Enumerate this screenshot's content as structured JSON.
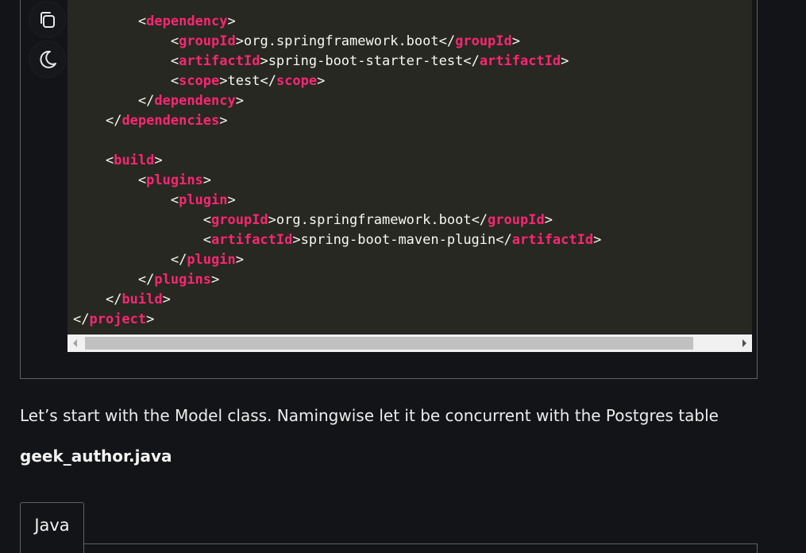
{
  "toolbar": {
    "copy_icon": "copy-icon",
    "theme_icon": "moon-icon"
  },
  "code": {
    "lines": [
      {
        "indent": "        ",
        "close": false,
        "tag": "dependency",
        "text": "",
        "end_tag": ""
      },
      {
        "indent": "            ",
        "close": false,
        "tag": "groupId",
        "text": "org.springframework.boot",
        "end_tag": "groupId"
      },
      {
        "indent": "            ",
        "close": false,
        "tag": "artifactId",
        "text": "spring-boot-starter-test",
        "end_tag": "artifactId"
      },
      {
        "indent": "            ",
        "close": false,
        "tag": "scope",
        "text": "test",
        "end_tag": "scope"
      },
      {
        "indent": "        ",
        "close": true,
        "tag": "dependency",
        "text": "",
        "end_tag": ""
      },
      {
        "indent": "    ",
        "close": true,
        "tag": "dependencies",
        "text": "",
        "end_tag": ""
      },
      {
        "indent": "",
        "close": false,
        "tag": "",
        "text": "",
        "end_tag": ""
      },
      {
        "indent": "    ",
        "close": false,
        "tag": "build",
        "text": "",
        "end_tag": ""
      },
      {
        "indent": "        ",
        "close": false,
        "tag": "plugins",
        "text": "",
        "end_tag": ""
      },
      {
        "indent": "            ",
        "close": false,
        "tag": "plugin",
        "text": "",
        "end_tag": ""
      },
      {
        "indent": "                ",
        "close": false,
        "tag": "groupId",
        "text": "org.springframework.boot",
        "end_tag": "groupId"
      },
      {
        "indent": "                ",
        "close": false,
        "tag": "artifactId",
        "text": "spring-boot-maven-plugin",
        "end_tag": "artifactId"
      },
      {
        "indent": "            ",
        "close": true,
        "tag": "plugin",
        "text": "",
        "end_tag": ""
      },
      {
        "indent": "        ",
        "close": true,
        "tag": "plugins",
        "text": "",
        "end_tag": ""
      },
      {
        "indent": "    ",
        "close": true,
        "tag": "build",
        "text": "",
        "end_tag": ""
      },
      {
        "indent": "",
        "close": true,
        "tag": "project",
        "text": "",
        "end_tag": ""
      }
    ]
  },
  "article": {
    "paragraph": "Let’s start with the Model class. Namingwise let it be concurrent with the Postgres table",
    "filename": "geek_author.java"
  },
  "tabs": [
    {
      "label": "Java",
      "active": true
    }
  ],
  "colors": {
    "tag": "#f92672",
    "code_text": "#f8f8f2",
    "code_bg": "#272822",
    "page_bg": "#131417"
  }
}
